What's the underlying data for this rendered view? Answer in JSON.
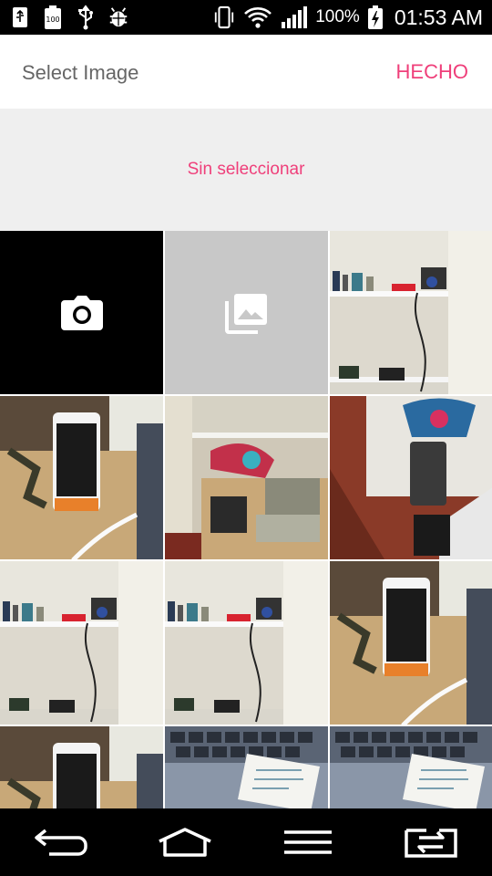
{
  "status_bar": {
    "battery_percent": "100%",
    "time": "01:53 AM",
    "left_icons": [
      "usb-storage-icon",
      "battery-100-icon",
      "usb-icon",
      "android-debug-icon"
    ],
    "right_icons": [
      "vibrate-icon",
      "wifi-icon",
      "signal-icon",
      "battery-charging-icon"
    ]
  },
  "header": {
    "title": "Select Image",
    "done_label": "HECHO"
  },
  "selection": {
    "empty_text": "Sin seleccionar"
  },
  "grid": {
    "tiles": [
      {
        "kind": "camera",
        "icon": "camera-icon"
      },
      {
        "kind": "gallery",
        "icon": "gallery-icon"
      },
      {
        "kind": "photo",
        "scene": "shelf"
      },
      {
        "kind": "photo",
        "scene": "phone"
      },
      {
        "kind": "photo",
        "scene": "shelf-blur"
      },
      {
        "kind": "photo",
        "scene": "floor"
      },
      {
        "kind": "photo",
        "scene": "shelf"
      },
      {
        "kind": "photo",
        "scene": "shelf"
      },
      {
        "kind": "photo",
        "scene": "phone"
      },
      {
        "kind": "photo",
        "scene": "phone"
      },
      {
        "kind": "photo",
        "scene": "keyboard"
      },
      {
        "kind": "photo",
        "scene": "keyboard"
      }
    ]
  },
  "nav_bar": {
    "buttons": [
      "back-icon",
      "home-icon",
      "menu-icon",
      "dual-window-icon"
    ]
  },
  "colors": {
    "accent": "#ef3f7a",
    "title_gray": "#666666",
    "selection_bg": "#efefef",
    "gallery_bg": "#c8c8c8"
  }
}
